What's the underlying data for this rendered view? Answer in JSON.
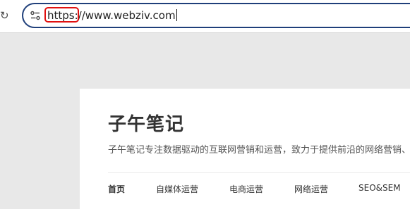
{
  "browser": {
    "reload_icon": "reload-icon",
    "site_info_icon": "tune-icon",
    "url": {
      "scheme": "https:",
      "rest": "//www.webziv.com"
    },
    "accent_color": "#1f3f7a",
    "highlight_color": "#e01010"
  },
  "site": {
    "title": "子午笔记",
    "description": "子午笔记专注数据驱动的互联网营销和运营，致力于提供前沿的网络营销、",
    "nav": [
      {
        "label": "首页",
        "active": true
      },
      {
        "label": "自媒体运营"
      },
      {
        "label": "电商运营"
      },
      {
        "label": "网络运营"
      },
      {
        "label": "SEO&SEM"
      }
    ]
  }
}
